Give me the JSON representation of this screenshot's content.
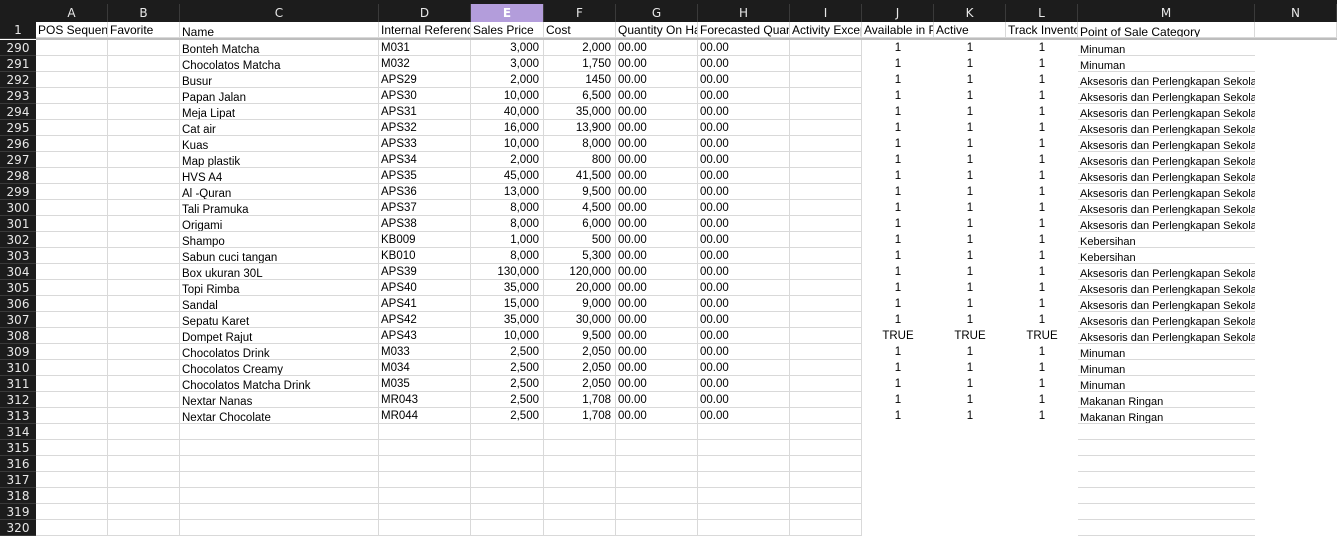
{
  "columns": [
    "A",
    "B",
    "C",
    "D",
    "E",
    "F",
    "G",
    "H",
    "I",
    "J",
    "K",
    "L",
    "M",
    "N"
  ],
  "selected_column": "E",
  "header_row": {
    "row_number": "1",
    "cells": [
      "POS Sequence",
      "Favorite",
      "Name",
      "Internal Reference",
      "Sales Price",
      "Cost",
      "Quantity On Hand",
      "Forecasted Quantity",
      "Activity Exception Decoration",
      "Available in POS",
      "Active",
      "Track Inventory",
      "Point of Sale Category",
      ""
    ]
  },
  "rows": [
    {
      "n": "290",
      "name": "Bonteh Matcha",
      "ref": "M031",
      "price": "3,000",
      "cost": "2,000",
      "qoh": "00.00",
      "fq": "00.00",
      "pos": "1",
      "active": "1",
      "track": "1",
      "cat": "Minuman"
    },
    {
      "n": "291",
      "name": "Chocolatos Matcha",
      "ref": "M032",
      "price": "3,000",
      "cost": "1,750",
      "qoh": "00.00",
      "fq": "00.00",
      "pos": "1",
      "active": "1",
      "track": "1",
      "cat": "Minuman"
    },
    {
      "n": "292",
      "name": "Busur",
      "ref": "APS29",
      "price": "2,000",
      "cost": "1450",
      "qoh": "00.00",
      "fq": "00.00",
      "pos": "1",
      "active": "1",
      "track": "1",
      "cat": "Aksesoris dan Perlengkapan Sekolah"
    },
    {
      "n": "293",
      "name": "Papan Jalan",
      "ref": "APS30",
      "price": "10,000",
      "cost": "6,500",
      "qoh": "00.00",
      "fq": "00.00",
      "pos": "1",
      "active": "1",
      "track": "1",
      "cat": "Aksesoris dan Perlengkapan Sekolah"
    },
    {
      "n": "294",
      "name": "Meja Lipat",
      "ref": "APS31",
      "price": "40,000",
      "cost": "35,000",
      "qoh": "00.00",
      "fq": "00.00",
      "pos": "1",
      "active": "1",
      "track": "1",
      "cat": "Aksesoris dan Perlengkapan Sekolah"
    },
    {
      "n": "295",
      "name": "Cat air",
      "ref": "APS32",
      "price": "16,000",
      "cost": "13,900",
      "qoh": "00.00",
      "fq": "00.00",
      "pos": "1",
      "active": "1",
      "track": "1",
      "cat": "Aksesoris dan Perlengkapan Sekolah"
    },
    {
      "n": "296",
      "name": "Kuas",
      "ref": "APS33",
      "price": "10,000",
      "cost": "8,000",
      "qoh": "00.00",
      "fq": "00.00",
      "pos": "1",
      "active": "1",
      "track": "1",
      "cat": "Aksesoris dan Perlengkapan Sekolah"
    },
    {
      "n": "297",
      "name": "Map plastik",
      "ref": "APS34",
      "price": "2,000",
      "cost": "800",
      "qoh": "00.00",
      "fq": "00.00",
      "pos": "1",
      "active": "1",
      "track": "1",
      "cat": "Aksesoris dan Perlengkapan Sekolah"
    },
    {
      "n": "298",
      "name": "HVS A4",
      "ref": "APS35",
      "price": "45,000",
      "cost": "41,500",
      "qoh": "00.00",
      "fq": "00.00",
      "pos": "1",
      "active": "1",
      "track": "1",
      "cat": "Aksesoris dan Perlengkapan Sekolah"
    },
    {
      "n": "299",
      "name": "Al -Quran",
      "ref": "APS36",
      "price": "13,000",
      "cost": "9,500",
      "qoh": "00.00",
      "fq": "00.00",
      "pos": "1",
      "active": "1",
      "track": "1",
      "cat": "Aksesoris dan Perlengkapan Sekolah"
    },
    {
      "n": "300",
      "name": "Tali Pramuka",
      "ref": "APS37",
      "price": "8,000",
      "cost": "4,500",
      "qoh": "00.00",
      "fq": "00.00",
      "pos": "1",
      "active": "1",
      "track": "1",
      "cat": "Aksesoris dan Perlengkapan Sekolah"
    },
    {
      "n": "301",
      "name": "Origami",
      "ref": "APS38",
      "price": "8,000",
      "cost": "6,000",
      "qoh": "00.00",
      "fq": "00.00",
      "pos": "1",
      "active": "1",
      "track": "1",
      "cat": "Aksesoris dan Perlengkapan Sekolah"
    },
    {
      "n": "302",
      "name": "Shampo",
      "ref": "KB009",
      "price": "1,000",
      "cost": "500",
      "qoh": "00.00",
      "fq": "00.00",
      "pos": "1",
      "active": "1",
      "track": "1",
      "cat": "Kebersihan"
    },
    {
      "n": "303",
      "name": "Sabun cuci tangan",
      "ref": "KB010",
      "price": "8,000",
      "cost": "5,300",
      "qoh": "00.00",
      "fq": "00.00",
      "pos": "1",
      "active": "1",
      "track": "1",
      "cat": "Kebersihan"
    },
    {
      "n": "304",
      "name": "Box ukuran 30L",
      "ref": "APS39",
      "price": "130,000",
      "cost": "120,000",
      "qoh": "00.00",
      "fq": "00.00",
      "pos": "1",
      "active": "1",
      "track": "1",
      "cat": "Aksesoris dan Perlengkapan Sekolah"
    },
    {
      "n": "305",
      "name": "Topi Rimba",
      "ref": "APS40",
      "price": "35,000",
      "cost": "20,000",
      "qoh": "00.00",
      "fq": "00.00",
      "pos": "1",
      "active": "1",
      "track": "1",
      "cat": "Aksesoris dan Perlengkapan Sekolah"
    },
    {
      "n": "306",
      "name": "Sandal",
      "ref": "APS41",
      "price": "15,000",
      "cost": "9,000",
      "qoh": "00.00",
      "fq": "00.00",
      "pos": "1",
      "active": "1",
      "track": "1",
      "cat": "Aksesoris dan Perlengkapan Sekolah"
    },
    {
      "n": "307",
      "name": "Sepatu Karet",
      "ref": "APS42",
      "price": "35,000",
      "cost": "30,000",
      "qoh": "00.00",
      "fq": "00.00",
      "pos": "1",
      "active": "1",
      "track": "1",
      "cat": "Aksesoris dan Perlengkapan Sekolah"
    },
    {
      "n": "308",
      "name": "Dompet Rajut",
      "ref": "APS43",
      "price": "10,000",
      "cost": "9,500",
      "qoh": "00.00",
      "fq": "00.00",
      "pos": "TRUE",
      "active": "TRUE",
      "track": "TRUE",
      "cat": "Aksesoris dan Perlengkapan Sekolah"
    },
    {
      "n": "309",
      "name": "Chocolatos Drink",
      "ref": "M033",
      "price": "2,500",
      "cost": "2,050",
      "qoh": "00.00",
      "fq": "00.00",
      "pos": "1",
      "active": "1",
      "track": "1",
      "cat": "Minuman"
    },
    {
      "n": "310",
      "name": "Chocolatos Creamy",
      "ref": "M034",
      "price": "2,500",
      "cost": "2,050",
      "qoh": "00.00",
      "fq": "00.00",
      "pos": "1",
      "active": "1",
      "track": "1",
      "cat": "Minuman"
    },
    {
      "n": "311",
      "name": "Chocolatos Matcha Drink",
      "ref": "M035",
      "price": "2,500",
      "cost": "2,050",
      "qoh": "00.00",
      "fq": "00.00",
      "pos": "1",
      "active": "1",
      "track": "1",
      "cat": "Minuman"
    },
    {
      "n": "312",
      "name": "Nextar Nanas",
      "ref": "MR043",
      "price": "2,500",
      "cost": "1,708",
      "qoh": "00.00",
      "fq": "00.00",
      "pos": "1",
      "active": "1",
      "track": "1",
      "cat": "Makanan Ringan"
    },
    {
      "n": "313",
      "name": "Nextar Chocolate",
      "ref": "MR044",
      "price": "2,500",
      "cost": "1,708",
      "qoh": "00.00",
      "fq": "00.00",
      "pos": "1",
      "active": "1",
      "track": "1",
      "cat": "Makanan Ringan"
    },
    {
      "n": "314"
    },
    {
      "n": "315"
    },
    {
      "n": "316"
    },
    {
      "n": "317"
    },
    {
      "n": "318"
    },
    {
      "n": "319"
    },
    {
      "n": "320"
    }
  ],
  "colors": {
    "header_bg": "#1c1c1c",
    "selected_col": "#b39ddb",
    "grid": "#d9d9d9",
    "spell": "#e53935"
  }
}
